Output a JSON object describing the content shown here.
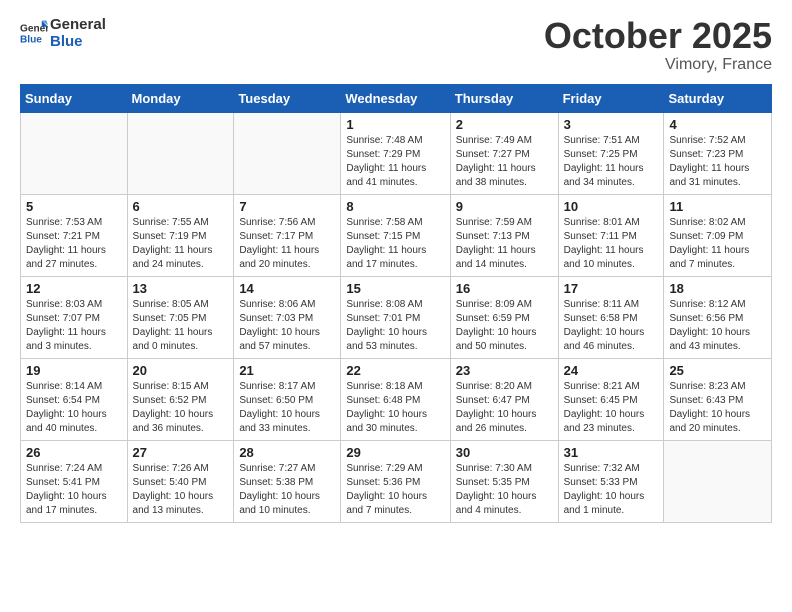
{
  "header": {
    "logo_line1": "General",
    "logo_line2": "Blue",
    "month": "October 2025",
    "location": "Vimory, France"
  },
  "weekdays": [
    "Sunday",
    "Monday",
    "Tuesday",
    "Wednesday",
    "Thursday",
    "Friday",
    "Saturday"
  ],
  "weeks": [
    [
      {
        "day": "",
        "info": ""
      },
      {
        "day": "",
        "info": ""
      },
      {
        "day": "",
        "info": ""
      },
      {
        "day": "1",
        "info": "Sunrise: 7:48 AM\nSunset: 7:29 PM\nDaylight: 11 hours and 41 minutes."
      },
      {
        "day": "2",
        "info": "Sunrise: 7:49 AM\nSunset: 7:27 PM\nDaylight: 11 hours and 38 minutes."
      },
      {
        "day": "3",
        "info": "Sunrise: 7:51 AM\nSunset: 7:25 PM\nDaylight: 11 hours and 34 minutes."
      },
      {
        "day": "4",
        "info": "Sunrise: 7:52 AM\nSunset: 7:23 PM\nDaylight: 11 hours and 31 minutes."
      }
    ],
    [
      {
        "day": "5",
        "info": "Sunrise: 7:53 AM\nSunset: 7:21 PM\nDaylight: 11 hours and 27 minutes."
      },
      {
        "day": "6",
        "info": "Sunrise: 7:55 AM\nSunset: 7:19 PM\nDaylight: 11 hours and 24 minutes."
      },
      {
        "day": "7",
        "info": "Sunrise: 7:56 AM\nSunset: 7:17 PM\nDaylight: 11 hours and 20 minutes."
      },
      {
        "day": "8",
        "info": "Sunrise: 7:58 AM\nSunset: 7:15 PM\nDaylight: 11 hours and 17 minutes."
      },
      {
        "day": "9",
        "info": "Sunrise: 7:59 AM\nSunset: 7:13 PM\nDaylight: 11 hours and 14 minutes."
      },
      {
        "day": "10",
        "info": "Sunrise: 8:01 AM\nSunset: 7:11 PM\nDaylight: 11 hours and 10 minutes."
      },
      {
        "day": "11",
        "info": "Sunrise: 8:02 AM\nSunset: 7:09 PM\nDaylight: 11 hours and 7 minutes."
      }
    ],
    [
      {
        "day": "12",
        "info": "Sunrise: 8:03 AM\nSunset: 7:07 PM\nDaylight: 11 hours and 3 minutes."
      },
      {
        "day": "13",
        "info": "Sunrise: 8:05 AM\nSunset: 7:05 PM\nDaylight: 11 hours and 0 minutes."
      },
      {
        "day": "14",
        "info": "Sunrise: 8:06 AM\nSunset: 7:03 PM\nDaylight: 10 hours and 57 minutes."
      },
      {
        "day": "15",
        "info": "Sunrise: 8:08 AM\nSunset: 7:01 PM\nDaylight: 10 hours and 53 minutes."
      },
      {
        "day": "16",
        "info": "Sunrise: 8:09 AM\nSunset: 6:59 PM\nDaylight: 10 hours and 50 minutes."
      },
      {
        "day": "17",
        "info": "Sunrise: 8:11 AM\nSunset: 6:58 PM\nDaylight: 10 hours and 46 minutes."
      },
      {
        "day": "18",
        "info": "Sunrise: 8:12 AM\nSunset: 6:56 PM\nDaylight: 10 hours and 43 minutes."
      }
    ],
    [
      {
        "day": "19",
        "info": "Sunrise: 8:14 AM\nSunset: 6:54 PM\nDaylight: 10 hours and 40 minutes."
      },
      {
        "day": "20",
        "info": "Sunrise: 8:15 AM\nSunset: 6:52 PM\nDaylight: 10 hours and 36 minutes."
      },
      {
        "day": "21",
        "info": "Sunrise: 8:17 AM\nSunset: 6:50 PM\nDaylight: 10 hours and 33 minutes."
      },
      {
        "day": "22",
        "info": "Sunrise: 8:18 AM\nSunset: 6:48 PM\nDaylight: 10 hours and 30 minutes."
      },
      {
        "day": "23",
        "info": "Sunrise: 8:20 AM\nSunset: 6:47 PM\nDaylight: 10 hours and 26 minutes."
      },
      {
        "day": "24",
        "info": "Sunrise: 8:21 AM\nSunset: 6:45 PM\nDaylight: 10 hours and 23 minutes."
      },
      {
        "day": "25",
        "info": "Sunrise: 8:23 AM\nSunset: 6:43 PM\nDaylight: 10 hours and 20 minutes."
      }
    ],
    [
      {
        "day": "26",
        "info": "Sunrise: 7:24 AM\nSunset: 5:41 PM\nDaylight: 10 hours and 17 minutes."
      },
      {
        "day": "27",
        "info": "Sunrise: 7:26 AM\nSunset: 5:40 PM\nDaylight: 10 hours and 13 minutes."
      },
      {
        "day": "28",
        "info": "Sunrise: 7:27 AM\nSunset: 5:38 PM\nDaylight: 10 hours and 10 minutes."
      },
      {
        "day": "29",
        "info": "Sunrise: 7:29 AM\nSunset: 5:36 PM\nDaylight: 10 hours and 7 minutes."
      },
      {
        "day": "30",
        "info": "Sunrise: 7:30 AM\nSunset: 5:35 PM\nDaylight: 10 hours and 4 minutes."
      },
      {
        "day": "31",
        "info": "Sunrise: 7:32 AM\nSunset: 5:33 PM\nDaylight: 10 hours and 1 minute."
      },
      {
        "day": "",
        "info": ""
      }
    ]
  ]
}
